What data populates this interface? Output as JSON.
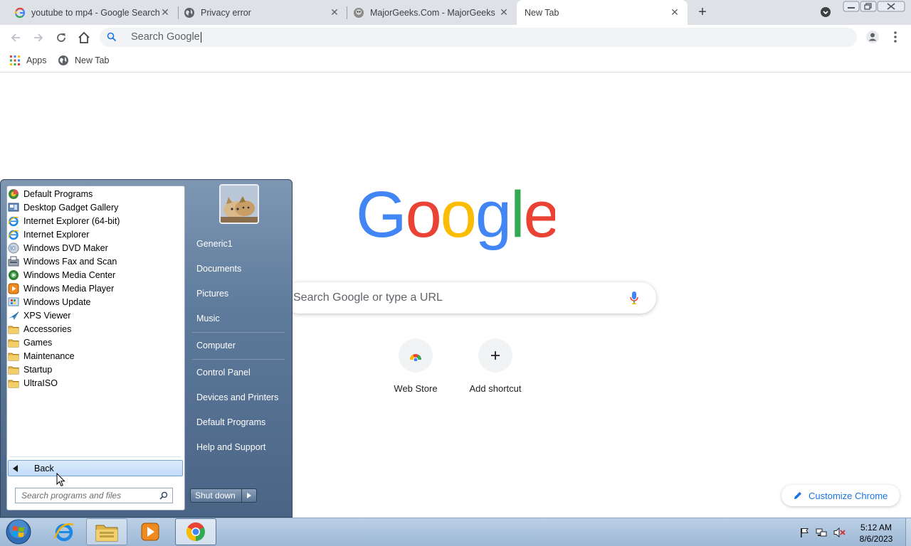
{
  "browser": {
    "tabs": [
      {
        "title": "youtube to mp4 - Google Search",
        "icon": "google-g-icon"
      },
      {
        "title": "Privacy error",
        "icon": "globe-icon"
      },
      {
        "title": "MajorGeeks.Com - MajorGeeks",
        "icon": "majorgeeks-icon"
      },
      {
        "title": "New Tab",
        "icon": "none",
        "active": true
      }
    ],
    "omnibox_placeholder": "Search Google",
    "bookmarks": [
      {
        "label": "Apps",
        "icon": "apps-grid-icon"
      },
      {
        "label": "New Tab",
        "icon": "globe-icon"
      }
    ]
  },
  "ntp": {
    "logo": "Google",
    "search_placeholder": "Search Google or type a URL",
    "shortcuts": [
      {
        "label": "Web Store",
        "icon": "webstore-icon"
      },
      {
        "label": "Add shortcut",
        "icon": "plus-icon"
      }
    ],
    "customize_label": "Customize Chrome"
  },
  "start_menu": {
    "programs": [
      {
        "label": "Default Programs",
        "icon": "default-programs-icon"
      },
      {
        "label": "Desktop Gadget Gallery",
        "icon": "gadget-icon"
      },
      {
        "label": "Internet Explorer (64-bit)",
        "icon": "ie-icon"
      },
      {
        "label": "Internet Explorer",
        "icon": "ie-icon"
      },
      {
        "label": "Windows DVD Maker",
        "icon": "dvd-icon"
      },
      {
        "label": "Windows Fax and Scan",
        "icon": "fax-icon"
      },
      {
        "label": "Windows Media Center",
        "icon": "media-center-icon"
      },
      {
        "label": "Windows Media Player",
        "icon": "media-player-icon"
      },
      {
        "label": "Windows Update",
        "icon": "update-icon"
      },
      {
        "label": "XPS Viewer",
        "icon": "xps-icon"
      },
      {
        "label": "Accessories",
        "icon": "folder-icon"
      },
      {
        "label": "Games",
        "icon": "folder-icon"
      },
      {
        "label": "Maintenance",
        "icon": "folder-icon"
      },
      {
        "label": "Startup",
        "icon": "folder-icon"
      },
      {
        "label": "UltraISO",
        "icon": "folder-icon"
      }
    ],
    "back_label": "Back",
    "search_placeholder": "Search programs and files",
    "right_links": [
      "Generic1",
      "Documents",
      "Pictures",
      "Music",
      "Computer",
      "Control Panel",
      "Devices and Printers",
      "Default Programs",
      "Help and Support"
    ],
    "shutdown_label": "Shut down"
  },
  "taskbar": {
    "time": "5:12 AM",
    "date": "8/6/2023",
    "pinned": [
      "start-orb-icon",
      "ie-icon",
      "explorer-icon",
      "media-player-icon",
      "chrome-icon"
    ]
  },
  "colors": {
    "google_blue": "#4285f4",
    "google_red": "#ea4335",
    "google_yellow": "#fbbc05",
    "google_green": "#34a853",
    "link_blue": "#1a73e8"
  }
}
